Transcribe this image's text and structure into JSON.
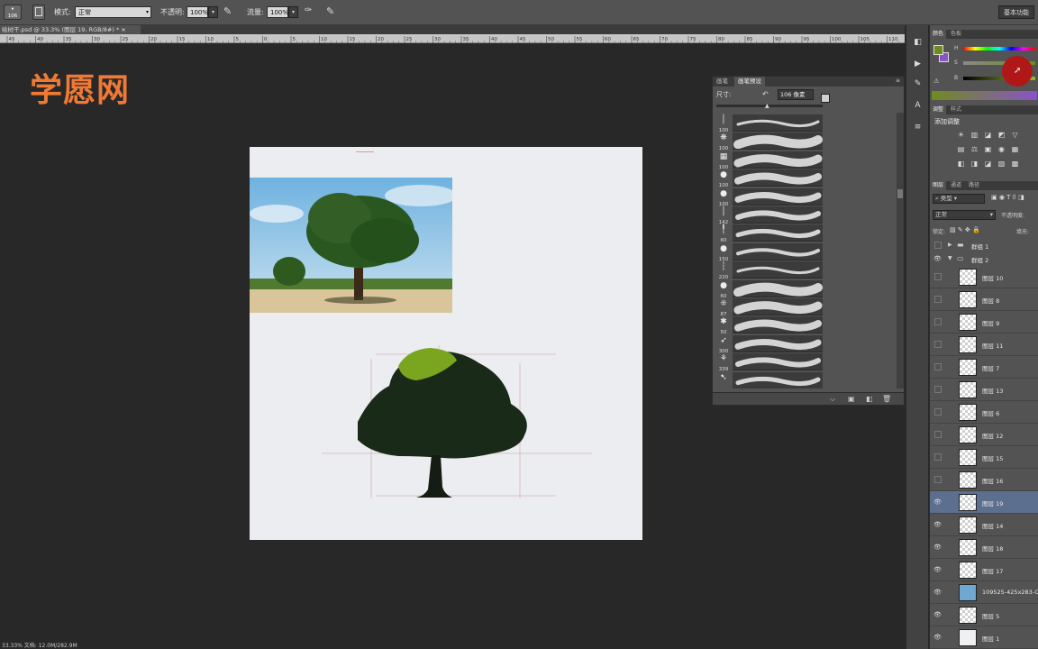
{
  "options": {
    "brush_size": "106",
    "mode_label": "模式:",
    "mode_value": "正常",
    "opacity_label": "不透明:",
    "opacity_value": "100%",
    "flow_label": "流量:",
    "flow_value": "100%",
    "workspace": "基本功能"
  },
  "document": {
    "tab_title": "绘树干.psd @ 33.3% (图层 19, RGB/8#) *",
    "ruler_ticks": [
      "45",
      "40",
      "35",
      "30",
      "25",
      "20",
      "15",
      "10",
      "5",
      "0",
      "5",
      "10",
      "15",
      "20",
      "25",
      "30",
      "35",
      "40",
      "45",
      "50",
      "55",
      "60",
      "65",
      "70",
      "75",
      "80",
      "85",
      "90",
      "95",
      "100",
      "105",
      "110",
      "115"
    ]
  },
  "watermark": "学愿网",
  "brush_panel": {
    "tabs": [
      "画笔",
      "画笔预设"
    ],
    "size_label": "尺寸:",
    "size_value": "106 像素",
    "brushes": [
      {
        "size": "100"
      },
      {
        "size": "100"
      },
      {
        "size": "100"
      },
      {
        "size": "100"
      },
      {
        "size": "100"
      },
      {
        "size": "142"
      },
      {
        "size": "60"
      },
      {
        "size": "150"
      },
      {
        "size": "220"
      },
      {
        "size": "60"
      },
      {
        "size": "87"
      },
      {
        "size": "50"
      },
      {
        "size": "300"
      },
      {
        "size": "339"
      },
      {
        "size": ""
      }
    ]
  },
  "color_panel": {
    "tabs": [
      "颜色",
      "色板"
    ],
    "slider_labels": [
      "H",
      "S",
      "B"
    ],
    "fg_color": "#6e8c1e",
    "bg_color": "#8a53c8"
  },
  "adjust_panel": {
    "tabs": [
      "调整",
      "样式"
    ],
    "title": "添加调整"
  },
  "layers_panel": {
    "tabs": [
      "图层",
      "通道",
      "路径"
    ],
    "kind_label": "类型",
    "blend_mode": "正常",
    "opacity_label": "不透明度:",
    "lock_label": "锁定:",
    "fill_label": "填充:",
    "groups": [
      {
        "name": "群组 1"
      },
      {
        "name": "群组 2"
      }
    ],
    "layers": [
      {
        "name": "图层 10",
        "visible": false,
        "selected": false
      },
      {
        "name": "图层 8",
        "visible": false,
        "selected": false
      },
      {
        "name": "图层 9",
        "visible": false,
        "selected": false
      },
      {
        "name": "图层 11",
        "visible": false,
        "selected": false
      },
      {
        "name": "图层 7",
        "visible": false,
        "selected": false
      },
      {
        "name": "图层 13",
        "visible": false,
        "selected": false
      },
      {
        "name": "图层 6",
        "visible": false,
        "selected": false
      },
      {
        "name": "图层 12",
        "visible": false,
        "selected": false
      },
      {
        "name": "图层 15",
        "visible": false,
        "selected": false
      },
      {
        "name": "图层 16",
        "visible": false,
        "selected": false
      },
      {
        "name": "图层 19",
        "visible": true,
        "selected": true
      },
      {
        "name": "图层 14",
        "visible": true,
        "selected": false
      },
      {
        "name": "图层 18",
        "visible": true,
        "selected": false
      },
      {
        "name": "图层 17",
        "visible": true,
        "selected": false
      },
      {
        "name": "109525-425x283-Oa",
        "visible": true,
        "selected": false
      },
      {
        "name": "图层 5",
        "visible": true,
        "selected": false
      },
      {
        "name": "图层 1",
        "visible": true,
        "selected": false
      }
    ]
  },
  "status": "33.33%   文档: 12.0M/282.9M"
}
